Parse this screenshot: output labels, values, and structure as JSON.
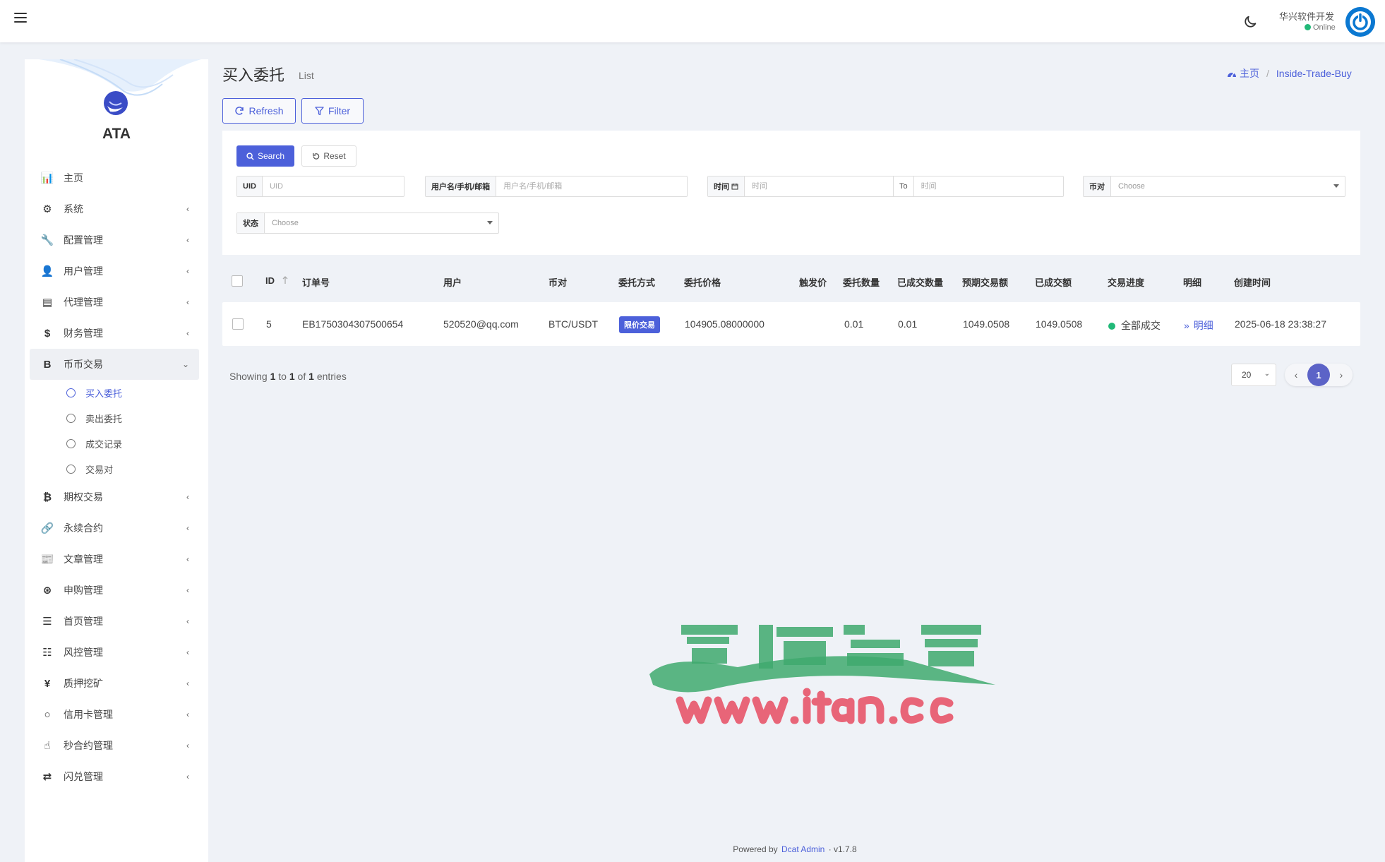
{
  "topbar": {
    "user_name": "华兴软件开发",
    "user_status": "Online"
  },
  "sidebar": {
    "brand": "ATA",
    "items": [
      {
        "label": "主页",
        "icon": "bar-chart-icon",
        "glyph": "📊",
        "has_chevron": false
      },
      {
        "label": "系统",
        "icon": "gear-icon",
        "glyph": "⚙",
        "has_chevron": true
      },
      {
        "label": "配置管理",
        "icon": "wrench-icon",
        "glyph": "🔧",
        "has_chevron": true
      },
      {
        "label": "用户管理",
        "icon": "user-icon",
        "glyph": "👤",
        "has_chevron": true
      },
      {
        "label": "代理管理",
        "icon": "id-card-icon",
        "glyph": "▤",
        "has_chevron": true
      },
      {
        "label": "财务管理",
        "icon": "dollar-icon",
        "glyph": "$",
        "has_chevron": true
      },
      {
        "label": "币币交易",
        "icon": "bitcoin-b-icon",
        "glyph": "B",
        "has_chevron": true,
        "open": true,
        "children": [
          {
            "label": "买入委托",
            "active": true
          },
          {
            "label": "卖出委托",
            "active": false
          },
          {
            "label": "成交记录",
            "active": false
          },
          {
            "label": "交易对",
            "active": false
          }
        ]
      },
      {
        "label": "期权交易",
        "icon": "bitcoin-icon",
        "glyph": "₿",
        "has_chevron": true
      },
      {
        "label": "永续合约",
        "icon": "link-icon",
        "glyph": "🔗",
        "has_chevron": true
      },
      {
        "label": "文章管理",
        "icon": "newspaper-icon",
        "glyph": "📰",
        "has_chevron": true
      },
      {
        "label": "申购管理",
        "icon": "lifebuoy-icon",
        "glyph": "⊛",
        "has_chevron": true
      },
      {
        "label": "首页管理",
        "icon": "list-icon",
        "glyph": "☰",
        "has_chevron": true
      },
      {
        "label": "风控管理",
        "icon": "indent-icon",
        "glyph": "☷",
        "has_chevron": true
      },
      {
        "label": "质押挖矿",
        "icon": "yen-icon",
        "glyph": "¥",
        "has_chevron": true
      },
      {
        "label": "信用卡管理",
        "icon": "circle-icon",
        "glyph": "○",
        "has_chevron": true
      },
      {
        "label": "秒合约管理",
        "icon": "fingerprint-icon",
        "glyph": "☝",
        "has_chevron": true
      },
      {
        "label": "闪兑管理",
        "icon": "exchange-icon",
        "glyph": "⇄",
        "has_chevron": true
      }
    ]
  },
  "header": {
    "title": "买入委托",
    "subtitle": "List",
    "breadcrumb_home": "主页",
    "breadcrumb_current": "Inside-Trade-Buy",
    "refresh_label": "Refresh",
    "filter_label": "Filter"
  },
  "filter": {
    "search_label": "Search",
    "reset_label": "Reset",
    "uid_label": "UID",
    "uid_placeholder": "UID",
    "user_label": "用户名/手机/邮箱",
    "user_placeholder": "用户名/手机/邮箱",
    "time_label": "时间",
    "time_from_placeholder": "时间",
    "time_to_label": "To",
    "time_to_placeholder": "时间",
    "pair_label": "币对",
    "pair_value": "Choose",
    "status_label": "状态",
    "status_value": "Choose"
  },
  "table": {
    "columns": [
      "ID",
      "订单号",
      "用户",
      "币对",
      "委托方式",
      "委托价格",
      "触发价",
      "委托数量",
      "已成交数量",
      "预期交易额",
      "已成交额",
      "交易进度",
      "明细",
      "创建时间"
    ],
    "rows": [
      {
        "id": "5",
        "order_no": "EB1750304307500654",
        "user": "520520@qq.com",
        "pair": "BTC/USDT",
        "method": "限价交易",
        "price": "104905.08000000",
        "trigger": "",
        "qty": "0.01",
        "filled_qty": "0.01",
        "expected_amount": "1049.0508",
        "filled_amount": "1049.0508",
        "progress": "全部成交",
        "detail": "明细",
        "created": "2025-06-18 23:38:27"
      }
    ]
  },
  "pagination": {
    "showing_prefix": "Showing",
    "from": "1",
    "to_word": "to",
    "to": "1",
    "of_word": "of",
    "total": "1",
    "entries_word": "entries",
    "per_page": "20",
    "current_page": "1"
  },
  "footer": {
    "powered_by": "Powered by",
    "brand_link": "Dcat Admin",
    "separator": "·",
    "version": "v1.7.8"
  },
  "colors": {
    "accent": "#4c60da",
    "success": "#21b978",
    "background": "#eff2f7"
  }
}
